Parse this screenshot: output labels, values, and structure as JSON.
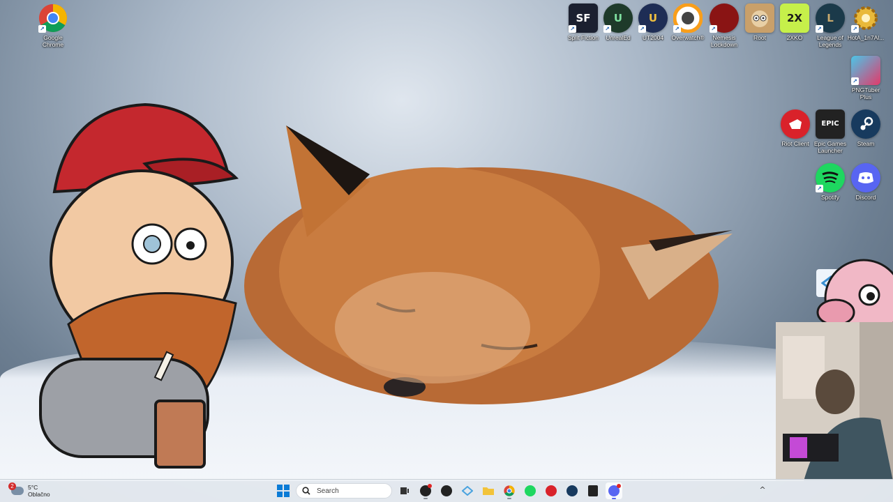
{
  "desktop": {
    "left_icons": [
      {
        "label": "Google Chrome",
        "icon": "chrome-icon"
      }
    ],
    "top_row": [
      {
        "label": "Split Fiction",
        "icon": "split-fiction-icon",
        "glyph": "SF",
        "bg": "#1b2030"
      },
      {
        "label": "UnrealEd",
        "icon": "unreal-editor-icon",
        "glyph": "U",
        "bg": "#1e3a2a"
      },
      {
        "label": "UT2004",
        "icon": "ut2004-icon",
        "glyph": "U",
        "bg": "#1e2d55"
      },
      {
        "label": "Overwatch®",
        "icon": "overwatch-icon",
        "glyph": "",
        "bg": "#f0f0f0"
      },
      {
        "label": "Nemesis Lockdown",
        "icon": "nemesis-lockdown-icon",
        "glyph": "",
        "bg": "#8a1414"
      },
      {
        "label": "Root",
        "icon": "root-icon",
        "glyph": "",
        "bg": "#c9a06a"
      },
      {
        "label": "2XKO",
        "icon": "2xko-icon",
        "glyph": "2X",
        "bg": "#c6f04a"
      },
      {
        "label": "League of Legends",
        "icon": "league-of-legends-icon",
        "glyph": "L",
        "bg": "#1b3a4a"
      },
      {
        "label": "HotA_1n7Al...",
        "icon": "hota-icon",
        "glyph": "",
        "bg": "#e9b93a"
      }
    ],
    "right_column": [
      {
        "label": "PNGTuber Plus",
        "icon": "pngtuber-plus-icon",
        "glyph": "",
        "bg": "#e23a6a"
      },
      {
        "label": "Riot Client",
        "icon": "riot-client-icon",
        "glyph": "",
        "bg": "#d9222a"
      },
      {
        "label": "Epic Games Launcher",
        "icon": "epic-games-icon",
        "glyph": "EPIC",
        "bg": "#222"
      },
      {
        "label": "Steam",
        "icon": "steam-icon",
        "glyph": "",
        "bg": "#173a5e"
      },
      {
        "label": "Spotify",
        "icon": "spotify-icon",
        "glyph": "",
        "bg": "#1ed760"
      },
      {
        "label": "Discord",
        "icon": "discord-icon",
        "glyph": "",
        "bg": "#5865f2"
      }
    ]
  },
  "taskbar": {
    "weather": {
      "temp": "5°C",
      "condition": "Oblačno",
      "badge": "2"
    },
    "search": {
      "placeholder": "Search"
    },
    "apps": [
      {
        "name": "task-view",
        "color": "#333"
      },
      {
        "name": "obs",
        "color": "#222"
      },
      {
        "name": "map-pin",
        "color": "#222"
      },
      {
        "name": "streamer-app",
        "color": "#4aa3df"
      },
      {
        "name": "file-explorer",
        "color": "#f2c33a"
      },
      {
        "name": "chrome",
        "color": "#db4437"
      },
      {
        "name": "spotify",
        "color": "#1ed760"
      },
      {
        "name": "riot-client",
        "color": "#d9222a"
      },
      {
        "name": "steam",
        "color": "#173a5e"
      },
      {
        "name": "epic-games",
        "color": "#222"
      },
      {
        "name": "discord",
        "color": "#5865f2"
      }
    ],
    "tray_chevron": "^"
  }
}
